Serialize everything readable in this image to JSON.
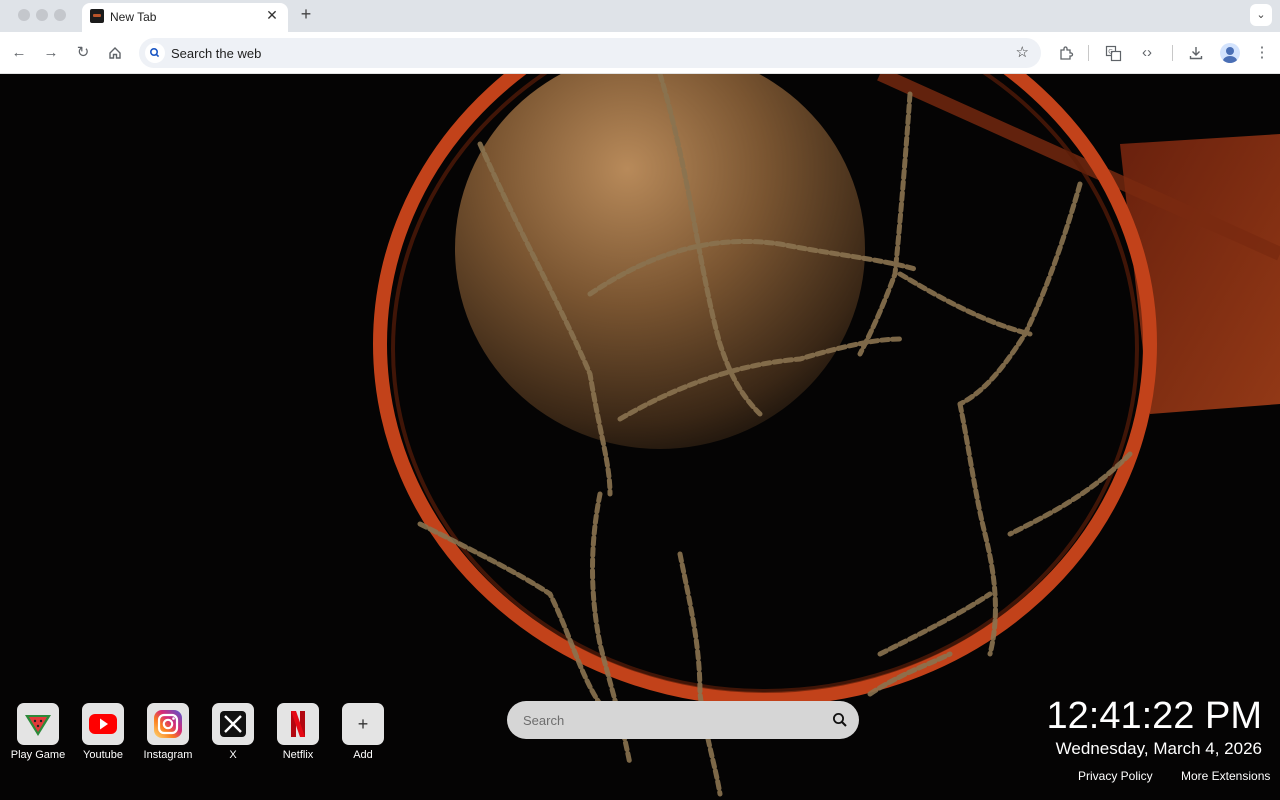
{
  "browser": {
    "tab": {
      "title": "New Tab"
    },
    "omnibox": {
      "text": "Search the web"
    }
  },
  "shortcuts": [
    {
      "label": "Play Game",
      "icon": "watermelon-icon"
    },
    {
      "label": "Youtube",
      "icon": "youtube-icon"
    },
    {
      "label": "Instagram",
      "icon": "instagram-icon"
    },
    {
      "label": "X",
      "icon": "x-icon"
    },
    {
      "label": "Netflix",
      "icon": "netflix-icon"
    },
    {
      "label": "Add",
      "icon": "plus-icon"
    }
  ],
  "search": {
    "placeholder": "Search"
  },
  "clock": {
    "time": "12:41:22 PM",
    "date": "Wednesday, March 4, 2026"
  },
  "footer": {
    "privacy": "Privacy Policy",
    "more": "More Extensions"
  },
  "colors": {
    "rim": "#c2421a",
    "background": "#050404",
    "chain": "#8a7350"
  }
}
